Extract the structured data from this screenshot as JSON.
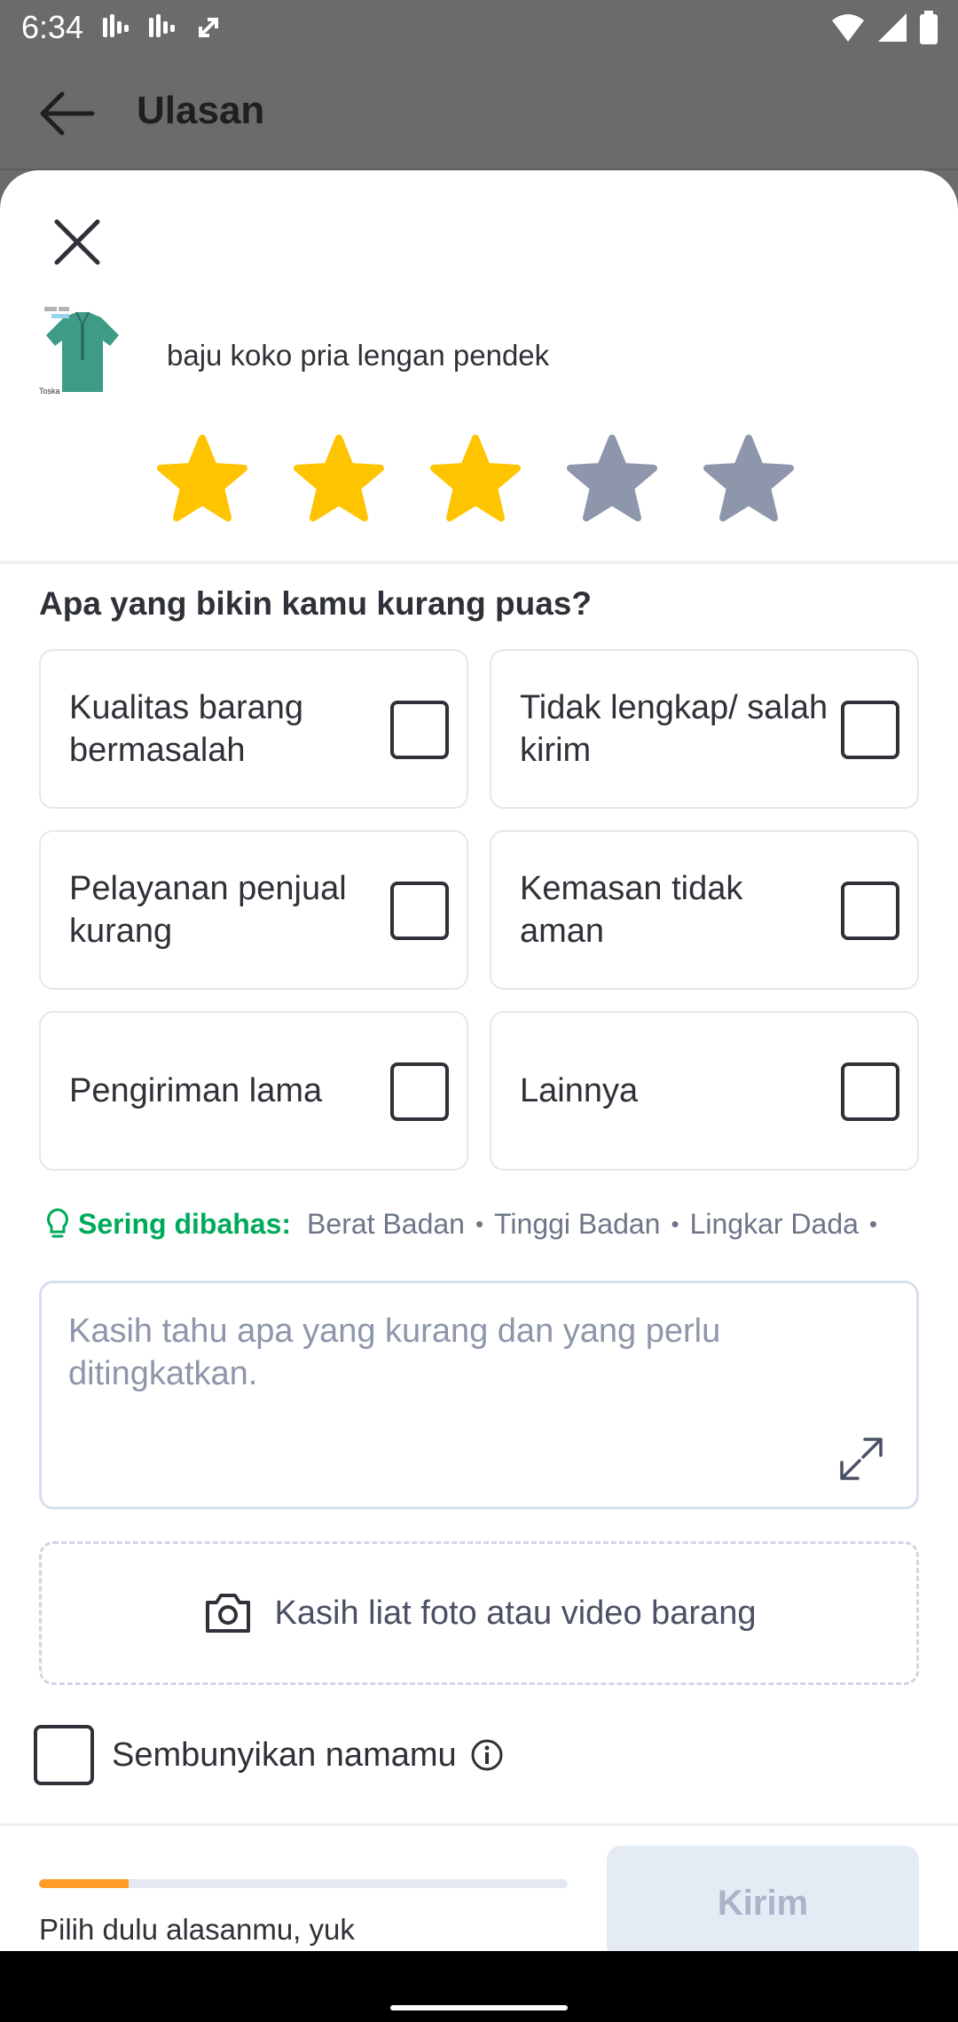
{
  "status_bar": {
    "time": "6:34",
    "notification_icons": [
      "signal-wave-icon",
      "signal-wave-icon",
      "sync-icon"
    ],
    "system_icons": [
      "wifi-icon",
      "cell-signal-icon",
      "battery-icon"
    ]
  },
  "app_bar": {
    "title": "Ulasan",
    "back_icon": "arrow-left-icon"
  },
  "sheet": {
    "close_icon": "close-icon",
    "product": {
      "name": "baju koko pria lengan pendek",
      "thumb_caption": "Toska"
    },
    "rating": {
      "value": 3,
      "max": 5,
      "filled_color": "#FFC400",
      "empty_color": "#8D96AA"
    },
    "question": "Apa yang bikin kamu kurang puas?",
    "options": [
      {
        "label": "Kualitas barang bermasalah",
        "checked": false
      },
      {
        "label": "Tidak lengkap/ salah kirim",
        "checked": false
      },
      {
        "label": "Pelayanan penjual kurang",
        "checked": false
      },
      {
        "label": "Kemasan tidak aman",
        "checked": false
      },
      {
        "label": "Pengiriman lama",
        "checked": false
      },
      {
        "label": "Lainnya",
        "checked": false
      }
    ],
    "topics": {
      "heading": "Sering dibahas:",
      "items": [
        "Berat Badan",
        "Tinggi Badan",
        "Lingkar Dada"
      ]
    },
    "review_input": {
      "placeholder": "Kasih tahu apa yang kurang dan yang perlu ditingkatkan.",
      "value": ""
    },
    "upload": {
      "label": "Kasih liat foto atau video barang",
      "icon": "camera-icon"
    },
    "anonymous": {
      "label": "Sembunyikan namamu",
      "checked": false,
      "info_icon": "info-icon"
    },
    "footer": {
      "progress_fraction": 0.17,
      "progress_color": "#FF9C28",
      "hint": "Pilih dulu alasanmu, yuk",
      "submit_label": "Kirim",
      "submit_enabled": false
    }
  }
}
